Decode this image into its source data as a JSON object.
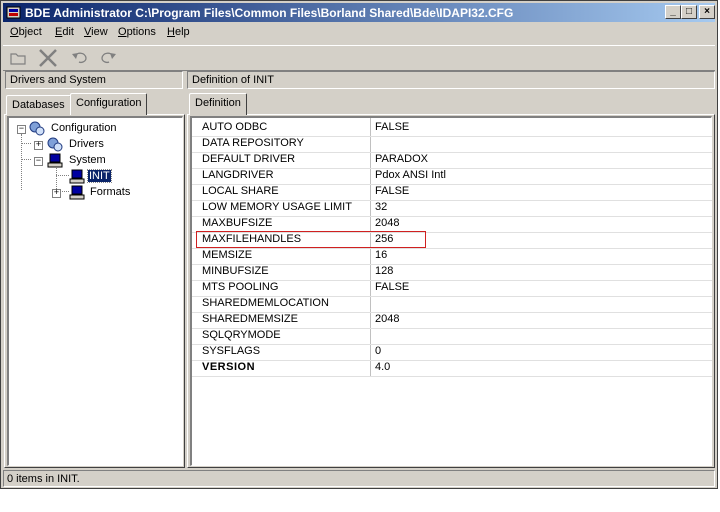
{
  "window": {
    "title": "BDE Administrator  C:\\Program Files\\Common Files\\Borland Shared\\Bde\\IDAPI32.CFG",
    "min_glyph": "_",
    "max_glyph": "□",
    "close_glyph": "×"
  },
  "menu": [
    {
      "accel": "O",
      "rest": "bject"
    },
    {
      "accel": "E",
      "rest": "dit"
    },
    {
      "accel": "V",
      "rest": "iew"
    },
    {
      "accel": "O",
      "rest": "ptions"
    },
    {
      "accel": "H",
      "rest": "elp"
    }
  ],
  "toolbar": {
    "icons": [
      "open-folder-icon",
      "delete-icon",
      "undo-icon",
      "redo-icon"
    ]
  },
  "left_panel": {
    "header": "Drivers and System",
    "tabs": [
      "Databases",
      "Configuration"
    ],
    "active_tab": "Configuration"
  },
  "tree": {
    "root": {
      "label": "Configuration",
      "expander": "−"
    },
    "drivers": {
      "label": "Drivers",
      "expander": "+"
    },
    "system": {
      "label": "System",
      "expander": "−"
    },
    "init": {
      "label": "INIT"
    },
    "formats": {
      "label": "Formats",
      "expander": "+"
    }
  },
  "right_panel": {
    "header": "Definition of INIT",
    "tabs": [
      "Definition"
    ]
  },
  "definition_rows": [
    {
      "key": "AUTO ODBC",
      "value": "FALSE"
    },
    {
      "key": "DATA REPOSITORY",
      "value": ""
    },
    {
      "key": "DEFAULT DRIVER",
      "value": "PARADOX"
    },
    {
      "key": "LANGDRIVER",
      "value": "Pdox ANSI Intl"
    },
    {
      "key": "LOCAL SHARE",
      "value": "FALSE"
    },
    {
      "key": "LOW MEMORY USAGE LIMIT",
      "value": "32"
    },
    {
      "key": "MAXBUFSIZE",
      "value": "2048"
    },
    {
      "key": "MAXFILEHANDLES",
      "value": "256"
    },
    {
      "key": "MEMSIZE",
      "value": "16"
    },
    {
      "key": "MINBUFSIZE",
      "value": "128"
    },
    {
      "key": "MTS POOLING",
      "value": "FALSE"
    },
    {
      "key": "SHAREDMEMLOCATION",
      "value": ""
    },
    {
      "key": "SHAREDMEMSIZE",
      "value": "2048"
    },
    {
      "key": "SQLQRYMODE",
      "value": ""
    },
    {
      "key": "SYSFLAGS",
      "value": "0"
    },
    {
      "key": "VERSION",
      "value": "4.0"
    }
  ],
  "status": {
    "text": "0 items in INIT."
  },
  "colors": {
    "titlebar_start": "#0a246a",
    "titlebar_end": "#a6caf0",
    "face": "#d4d0c8",
    "highlight_box": "#d02020"
  }
}
